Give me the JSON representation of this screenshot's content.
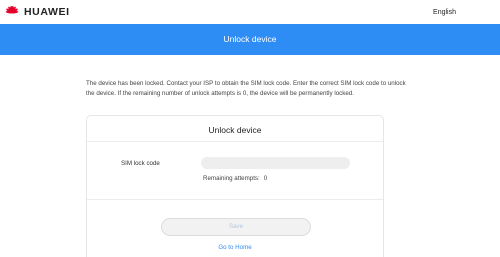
{
  "header": {
    "brand": "HUAWEI",
    "language": "English",
    "logo_icon": "huawei-flower-logo",
    "brand_color": "#e4002b"
  },
  "banner": {
    "title": "Unlock device",
    "color": "#2e8cf5"
  },
  "notice": "The device has been locked. Contact your ISP to obtain the SIM lock code. Enter the correct SIM lock code to unlock the device. If the remaining number of unlock attempts is 0, the device will be permanently locked.",
  "card": {
    "title": "Unlock device",
    "sim_label": "SIM lock code",
    "sim_value": "",
    "sim_placeholder": "",
    "attempts_label": "Remaining attempts:",
    "attempts_value": "0",
    "save_label": "Save",
    "home_link": "Go to Home"
  }
}
